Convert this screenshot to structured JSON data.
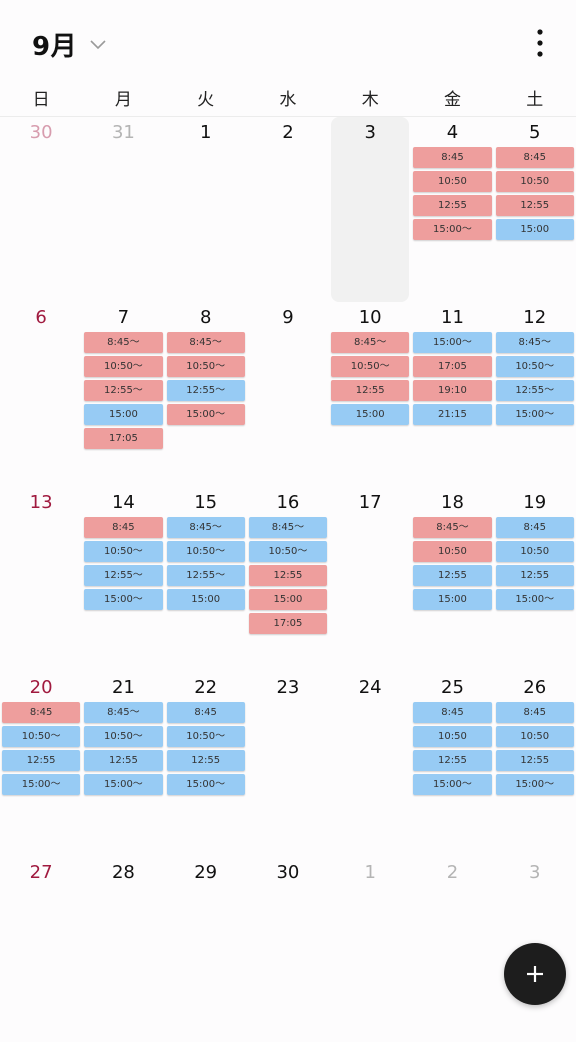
{
  "header": {
    "month_label": "9月"
  },
  "weekdays": [
    "日",
    "月",
    "火",
    "水",
    "木",
    "金",
    "土"
  ],
  "colors": {
    "red": "#ee9e9d",
    "blue": "#97cbf4",
    "sunday": "#a01a3f",
    "today_bg": "#f1f1f1"
  },
  "weeks": [
    [
      {
        "day": "30",
        "other": true,
        "events": []
      },
      {
        "day": "31",
        "other": true,
        "events": []
      },
      {
        "day": "1",
        "events": []
      },
      {
        "day": "2",
        "events": []
      },
      {
        "day": "3",
        "today": true,
        "events": []
      },
      {
        "day": "4",
        "events": [
          {
            "t": "8:45",
            "c": "red"
          },
          {
            "t": "10:50",
            "c": "red"
          },
          {
            "t": "12:55",
            "c": "red"
          },
          {
            "t": "15:00〜",
            "c": "red"
          }
        ]
      },
      {
        "day": "5",
        "events": [
          {
            "t": "8:45",
            "c": "red"
          },
          {
            "t": "10:50",
            "c": "red"
          },
          {
            "t": "12:55",
            "c": "red"
          },
          {
            "t": "15:00",
            "c": "blue"
          }
        ]
      }
    ],
    [
      {
        "day": "6",
        "events": []
      },
      {
        "day": "7",
        "events": [
          {
            "t": "8:45〜",
            "c": "red"
          },
          {
            "t": "10:50〜",
            "c": "red"
          },
          {
            "t": "12:55〜",
            "c": "red"
          },
          {
            "t": "15:00",
            "c": "blue"
          },
          {
            "t": "17:05",
            "c": "red"
          }
        ]
      },
      {
        "day": "8",
        "events": [
          {
            "t": "8:45〜",
            "c": "red"
          },
          {
            "t": "10:50〜",
            "c": "red"
          },
          {
            "t": "12:55〜",
            "c": "blue"
          },
          {
            "t": "15:00〜",
            "c": "red"
          }
        ]
      },
      {
        "day": "9",
        "events": []
      },
      {
        "day": "10",
        "events": [
          {
            "t": "8:45〜",
            "c": "red"
          },
          {
            "t": "10:50〜",
            "c": "red"
          },
          {
            "t": "12:55",
            "c": "red"
          },
          {
            "t": "15:00",
            "c": "blue"
          }
        ]
      },
      {
        "day": "11",
        "events": [
          {
            "t": "15:00〜",
            "c": "blue"
          },
          {
            "t": "17:05",
            "c": "red"
          },
          {
            "t": "19:10",
            "c": "red"
          },
          {
            "t": "21:15",
            "c": "blue"
          }
        ]
      },
      {
        "day": "12",
        "events": [
          {
            "t": "8:45〜",
            "c": "blue"
          },
          {
            "t": "10:50〜",
            "c": "blue"
          },
          {
            "t": "12:55〜",
            "c": "blue"
          },
          {
            "t": "15:00〜",
            "c": "blue"
          }
        ]
      }
    ],
    [
      {
        "day": "13",
        "events": []
      },
      {
        "day": "14",
        "events": [
          {
            "t": "8:45",
            "c": "red"
          },
          {
            "t": "10:50〜",
            "c": "blue"
          },
          {
            "t": "12:55〜",
            "c": "blue"
          },
          {
            "t": "15:00〜",
            "c": "blue"
          }
        ]
      },
      {
        "day": "15",
        "events": [
          {
            "t": "8:45〜",
            "c": "blue"
          },
          {
            "t": "10:50〜",
            "c": "blue"
          },
          {
            "t": "12:55〜",
            "c": "blue"
          },
          {
            "t": "15:00",
            "c": "blue"
          }
        ]
      },
      {
        "day": "16",
        "events": [
          {
            "t": "8:45〜",
            "c": "blue"
          },
          {
            "t": "10:50〜",
            "c": "blue"
          },
          {
            "t": "12:55",
            "c": "red"
          },
          {
            "t": "15:00",
            "c": "red"
          },
          {
            "t": "17:05",
            "c": "red"
          }
        ]
      },
      {
        "day": "17",
        "events": []
      },
      {
        "day": "18",
        "events": [
          {
            "t": "8:45〜",
            "c": "red"
          },
          {
            "t": "10:50",
            "c": "red"
          },
          {
            "t": "12:55",
            "c": "blue"
          },
          {
            "t": "15:00",
            "c": "blue"
          }
        ]
      },
      {
        "day": "19",
        "events": [
          {
            "t": "8:45",
            "c": "blue"
          },
          {
            "t": "10:50",
            "c": "blue"
          },
          {
            "t": "12:55",
            "c": "blue"
          },
          {
            "t": "15:00〜",
            "c": "blue"
          }
        ]
      }
    ],
    [
      {
        "day": "20",
        "events": [
          {
            "t": "8:45",
            "c": "red"
          },
          {
            "t": "10:50〜",
            "c": "blue"
          },
          {
            "t": "12:55",
            "c": "blue"
          },
          {
            "t": "15:00〜",
            "c": "blue"
          }
        ]
      },
      {
        "day": "21",
        "events": [
          {
            "t": "8:45〜",
            "c": "blue"
          },
          {
            "t": "10:50〜",
            "c": "blue"
          },
          {
            "t": "12:55",
            "c": "blue"
          },
          {
            "t": "15:00〜",
            "c": "blue"
          }
        ]
      },
      {
        "day": "22",
        "events": [
          {
            "t": "8:45",
            "c": "blue"
          },
          {
            "t": "10:50〜",
            "c": "blue"
          },
          {
            "t": "12:55",
            "c": "blue"
          },
          {
            "t": "15:00〜",
            "c": "blue"
          }
        ]
      },
      {
        "day": "23",
        "events": []
      },
      {
        "day": "24",
        "events": []
      },
      {
        "day": "25",
        "events": [
          {
            "t": "8:45",
            "c": "blue"
          },
          {
            "t": "10:50",
            "c": "blue"
          },
          {
            "t": "12:55",
            "c": "blue"
          },
          {
            "t": "15:00〜",
            "c": "blue"
          }
        ]
      },
      {
        "day": "26",
        "events": [
          {
            "t": "8:45",
            "c": "blue"
          },
          {
            "t": "10:50",
            "c": "blue"
          },
          {
            "t": "12:55",
            "c": "blue"
          },
          {
            "t": "15:00〜",
            "c": "blue"
          }
        ]
      }
    ],
    [
      {
        "day": "27",
        "events": []
      },
      {
        "day": "28",
        "events": []
      },
      {
        "day": "29",
        "events": []
      },
      {
        "day": "30",
        "events": []
      },
      {
        "day": "1",
        "other": true,
        "events": []
      },
      {
        "day": "2",
        "other": true,
        "events": []
      },
      {
        "day": "3",
        "other": true,
        "events": []
      }
    ]
  ]
}
